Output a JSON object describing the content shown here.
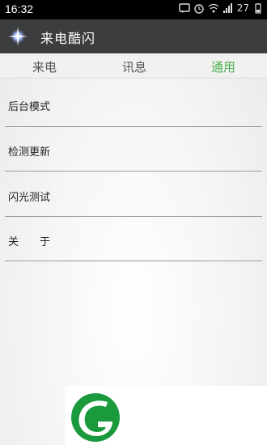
{
  "status_bar": {
    "time": "16:32",
    "battery": "27"
  },
  "app_bar": {
    "title": "来电酷闪"
  },
  "tabs": [
    {
      "label": "来电"
    },
    {
      "label": "讯息"
    },
    {
      "label": "通用",
      "active": true
    }
  ],
  "settings": {
    "items": [
      {
        "label": "后台模式"
      },
      {
        "label": "检测更新"
      },
      {
        "label": "闪光测试"
      },
      {
        "label": "关　　于"
      }
    ]
  },
  "colors": {
    "active_tab": "#4caf50",
    "app_bar_bg": "#3b3d3f",
    "promo_logo_green": "#1a9a3d"
  },
  "icons": {
    "app_logo": "sparkle-star-icon",
    "promo_logo": "green-g-leaf-logo"
  }
}
